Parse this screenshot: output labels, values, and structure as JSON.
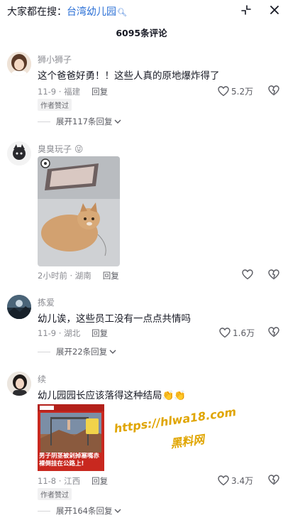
{
  "search_bar": {
    "prefix": "大家都在搜：",
    "keyword": "台湾幼儿园",
    "keyword_icon": "search-icon"
  },
  "header": {
    "comment_count": "6095条评论",
    "collapse_icon": "shrink-icon",
    "close_icon": "close-icon"
  },
  "comments": [
    {
      "username": "狮小狮子",
      "text": "这个爸爸好勇！！这些人真的原地爆炸得了",
      "date": "11-9",
      "location": "福建",
      "reply_label": "回复",
      "likes": "5.2万",
      "badge": "作者赞过",
      "expand_label": "展开117条回复"
    },
    {
      "username": "臭臭玩子",
      "username_emoji": "😜",
      "text": "",
      "date": "2小时前",
      "location": "湖南",
      "reply_label": "回复",
      "likes": "",
      "image": "cat-photo"
    },
    {
      "username": "拣爱",
      "text": "幼儿诶，这些员工没有一点点共情吗",
      "date": "11-9",
      "location": "湖北",
      "reply_label": "回复",
      "likes": "1.6万",
      "expand_label": "展开22条回复"
    },
    {
      "username": "续",
      "text": "幼儿园园长应该落得这种结局",
      "text_emoji": "👏👏",
      "date": "11-8",
      "location": "江西",
      "reply_label": "回复",
      "likes": "3.4万",
      "badge": "作者赞过",
      "expand_label": "展开164条回复",
      "image": "news-thumbnail",
      "thumbnail_caption": "男子阴茎被剁掉塞嘴赤裸倒挂在公路上!"
    }
  ],
  "watermark": {
    "url": "https://hlwa18.com",
    "label": "黑料网"
  },
  "colors": {
    "keyword": "#2a6fd6",
    "meta": "#8a8b91",
    "text": "#161823",
    "watermark": "#e0a500"
  }
}
